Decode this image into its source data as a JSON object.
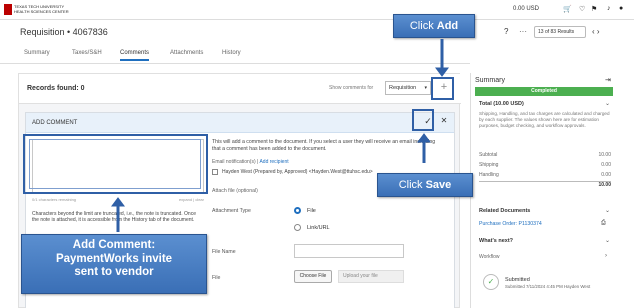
{
  "app": {
    "logo_text_line1": "TEXAS TECH UNIVERSITY",
    "logo_text_line2": "HEALTH SCIENCES CENTER",
    "cart": "0.00 USD",
    "icons": [
      "cart-icon",
      "heart-icon",
      "flag-icon",
      "bell-icon",
      "user-icon"
    ]
  },
  "header": {
    "title": "Requisition • 4067836",
    "results": "13 of 83 Results"
  },
  "tabs": [
    "Summary",
    "Taxes/S&H",
    "Comments",
    "Attachments",
    "History"
  ],
  "active_tab": "Comments",
  "records": {
    "found": "Records found: 0",
    "show_for": "Show comments for",
    "filter": "Requisition"
  },
  "add_comment": {
    "title": "ADD COMMENT",
    "textarea_meta_left": "0/1 characters remaining",
    "textarea_meta_right": "expand | clear",
    "note": "Characters beyond the limit are truncated, i.e., the note is truncated. Once the note is attached, it is accessible from the History tab of the document.",
    "info": "This will add a comment to the document. If you select a user they will receive an email indicating that a comment has been added to the document.",
    "email_label": "Email notification(s) |",
    "email_link": "Add recipient",
    "recipient": "Hayden West (Prepared by, Approved) <Hayden.West@ttuhsc.edu>",
    "attach_label": "Attach file (optional)",
    "attachment_type_label": "Attachment Type",
    "opt_file": "File",
    "opt_link": "Link/URL",
    "file_name_label": "File Name",
    "file_label": "File",
    "choose_file": "Choose File",
    "upload_placeholder": "Upload your file"
  },
  "summary": {
    "title": "Summary",
    "status": "Completed",
    "total_header": "Total (10.00 USD)",
    "description": "Shipping, Handling, and tax charges are calculated and charged by each supplier. The values shown here are for estimation purposes, budget checking, and workflow approvals.",
    "rows": [
      {
        "label": "Subtotal",
        "value": "10.00"
      },
      {
        "label": "Shipping",
        "value": "0.00"
      },
      {
        "label": "Handling",
        "value": "0.00"
      }
    ],
    "total_value": "10.00",
    "related_docs": "Related Documents",
    "po": "Purchase Order: P1130374",
    "whats_next": "What's next?",
    "workflow": "Workflow",
    "wf_title": "Submitted",
    "wf_detail": "Submitted 7/11/2024 4:45 PM   Hayden West"
  },
  "annotations": {
    "click_add_prefix": "Click ",
    "click_add_bold": "Add",
    "click_save_prefix": "Click ",
    "click_save_bold": "Save",
    "comment_line1": "Add Comment:",
    "comment_line2": "PaymentWorks invite",
    "comment_line3": "sent to vendor"
  }
}
